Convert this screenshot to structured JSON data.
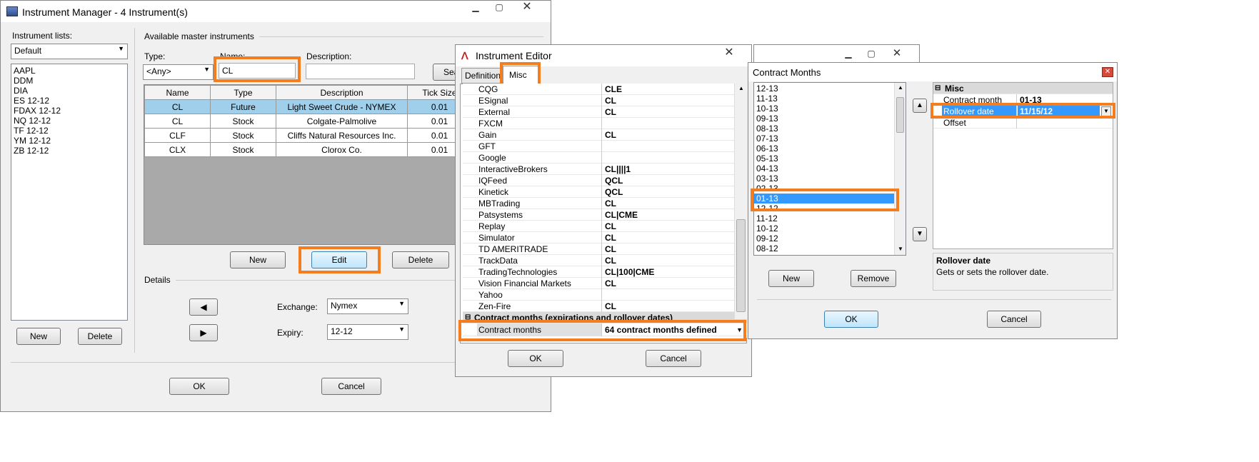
{
  "instrument_manager": {
    "title": "Instrument Manager - 4 Instrument(s)",
    "instrument_lists_label": "Instrument lists:",
    "list_selected": "Default",
    "list_items": [
      "AAPL",
      "DDM",
      "DIA",
      "ES 12-12",
      "FDAX 12-12",
      "NQ 12-12",
      "TF 12-12",
      "YM 12-12",
      "ZB 12-12"
    ],
    "new_label": "New",
    "delete_label": "Delete",
    "available_label": "Available master instruments",
    "type_label": "Type:",
    "type_value": "<Any>",
    "name_label": "Name:",
    "name_value": "CL",
    "description_label": "Description:",
    "description_value": "",
    "search_label": "Search",
    "columns": [
      "Name",
      "Type",
      "Description",
      "Tick Size"
    ],
    "rows": [
      [
        "CL",
        "Future",
        "Light Sweet Crude - NYMEX",
        "0.01"
      ],
      [
        "CL",
        "Stock",
        "Colgate-Palmolive",
        "0.01"
      ],
      [
        "CLF",
        "Stock",
        "Cliffs Natural Resources Inc.",
        "0.01"
      ],
      [
        "CLX",
        "Stock",
        "Clorox Co.",
        "0.01"
      ]
    ],
    "edit_label": "Edit",
    "details_label": "Details",
    "exchange_label": "Exchange:",
    "exchange_value": "Nymex",
    "expiry_label": "Expiry:",
    "expiry_value": "12-12",
    "ok_label": "OK",
    "cancel_label": "Cancel"
  },
  "instrument_editor": {
    "title": "Instrument Editor",
    "tab_definition": "Definition",
    "tab_misc": "Misc",
    "properties": [
      {
        "k": "CQG",
        "v": "CLE"
      },
      {
        "k": "ESignal",
        "v": "CL"
      },
      {
        "k": "External",
        "v": "CL"
      },
      {
        "k": "FXCM",
        "v": ""
      },
      {
        "k": "Gain",
        "v": "CL"
      },
      {
        "k": "GFT",
        "v": ""
      },
      {
        "k": "Google",
        "v": ""
      },
      {
        "k": "InteractiveBrokers",
        "v": "CL||||1"
      },
      {
        "k": "IQFeed",
        "v": "QCL"
      },
      {
        "k": "Kinetick",
        "v": "QCL"
      },
      {
        "k": "MBTrading",
        "v": "CL"
      },
      {
        "k": "Patsystems",
        "v": "CL|CME"
      },
      {
        "k": "Replay",
        "v": "CL"
      },
      {
        "k": "Simulator",
        "v": "CL"
      },
      {
        "k": "TD AMERITRADE",
        "v": "CL"
      },
      {
        "k": "TrackData",
        "v": "CL"
      },
      {
        "k": "TradingTechnologies",
        "v": "CL|100|CME"
      },
      {
        "k": "Vision Financial Markets",
        "v": "CL"
      },
      {
        "k": "Yahoo",
        "v": ""
      },
      {
        "k": "Zen-Fire",
        "v": "CL"
      }
    ],
    "category": "Contract months (expirations and rollover dates)",
    "contract_months_key": "Contract months",
    "contract_months_value": "64 contract months defined",
    "ok_label": "OK",
    "cancel_label": "Cancel"
  },
  "contract_months": {
    "title": "Contract Months",
    "months": [
      "12-13",
      "11-13",
      "10-13",
      "09-13",
      "08-13",
      "07-13",
      "06-13",
      "05-13",
      "04-13",
      "03-13",
      "02-13",
      "01-13",
      "12-12",
      "11-12",
      "10-12",
      "09-12",
      "08-12"
    ],
    "selected": "01-13",
    "misc_header": "Misc",
    "contract_month_key": "Contract month",
    "contract_month_value": "01-13",
    "rollover_key": "Rollover date",
    "rollover_value": "11/15/12",
    "offset_key": "Offset",
    "offset_value": "",
    "desc_title": "Rollover date",
    "desc_text": "Gets or sets the rollover date.",
    "new_label": "New",
    "remove_label": "Remove",
    "ok_label": "OK",
    "cancel_label": "Cancel"
  },
  "colors": {
    "highlight": "#f47d20",
    "selection": "#3399ff",
    "row_selected": "#9fcfea"
  }
}
